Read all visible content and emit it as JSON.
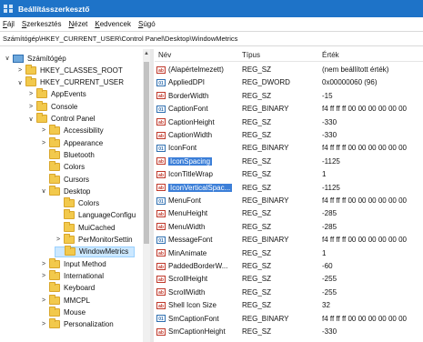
{
  "window": {
    "title": "Beállításszerkesztő"
  },
  "menu": [
    "Fájl",
    "Szerkesztés",
    "Nézet",
    "Kedvencek",
    "Súgó"
  ],
  "address": "Számítógép\\HKEY_CURRENT_USER\\Control Panel\\Desktop\\WindowMetrics",
  "tree": {
    "items": [
      {
        "label": "Számítógép",
        "type": "computer",
        "arrow": "∨"
      },
      {
        "label": "HKEY_CLASSES_ROOT",
        "type": "folder",
        "arrow": ">"
      },
      {
        "label": "HKEY_CURRENT_USER",
        "type": "folder",
        "arrow": "∨"
      },
      {
        "label": "AppEvents",
        "type": "folder",
        "arrow": ">"
      },
      {
        "label": "Console",
        "type": "folder",
        "arrow": ">"
      },
      {
        "label": "Control Panel",
        "type": "folder",
        "arrow": "∨"
      },
      {
        "label": "Accessibility",
        "type": "folder",
        "arrow": ">"
      },
      {
        "label": "Appearance",
        "type": "folder",
        "arrow": ">"
      },
      {
        "label": "Bluetooth",
        "type": "folder",
        "arrow": ""
      },
      {
        "label": "Colors",
        "type": "folder",
        "arrow": ""
      },
      {
        "label": "Cursors",
        "type": "folder",
        "arrow": ""
      },
      {
        "label": "Desktop",
        "type": "folder",
        "arrow": "∨"
      },
      {
        "label": "Colors",
        "type": "folder",
        "arrow": ""
      },
      {
        "label": "LanguageConfigu",
        "type": "folder",
        "arrow": ""
      },
      {
        "label": "MuiCached",
        "type": "folder",
        "arrow": ""
      },
      {
        "label": "PerMonitorSettin",
        "type": "folder",
        "arrow": ">"
      },
      {
        "label": "WindowMetrics",
        "type": "folder",
        "arrow": ""
      },
      {
        "label": "Input Method",
        "type": "folder",
        "arrow": ">"
      },
      {
        "label": "International",
        "type": "folder",
        "arrow": ">"
      },
      {
        "label": "Keyboard",
        "type": "folder",
        "arrow": ""
      },
      {
        "label": "MMCPL",
        "type": "folder",
        "arrow": ">"
      },
      {
        "label": "Mouse",
        "type": "folder",
        "arrow": ""
      },
      {
        "label": "Personalization",
        "type": "folder",
        "arrow": ">"
      }
    ]
  },
  "list": {
    "headers": {
      "name": "Név",
      "type": "Típus",
      "value": "Érték"
    },
    "rows": [
      {
        "name": "(Alapértelmezett)",
        "type": "REG_SZ",
        "value": "(nem beállított érték)",
        "icon": "ab"
      },
      {
        "name": "AppliedDPI",
        "type": "REG_DWORD",
        "value": "0x00000060 (96)",
        "icon": "bin"
      },
      {
        "name": "BorderWidth",
        "type": "REG_SZ",
        "value": "-15",
        "icon": "ab"
      },
      {
        "name": "CaptionFont",
        "type": "REG_BINARY",
        "value": "f4 ff ff ff 00 00 00 00 00 00",
        "icon": "bin"
      },
      {
        "name": "CaptionHeight",
        "type": "REG_SZ",
        "value": "-330",
        "icon": "ab"
      },
      {
        "name": "CaptionWidth",
        "type": "REG_SZ",
        "value": "-330",
        "icon": "ab"
      },
      {
        "name": "IconFont",
        "type": "REG_BINARY",
        "value": "f4 ff ff ff 00 00 00 00 00 00",
        "icon": "bin"
      },
      {
        "name": "IconSpacing",
        "type": "REG_SZ",
        "value": "-1125",
        "icon": "ab",
        "highlight": true
      },
      {
        "name": "IconTitleWrap",
        "type": "REG_SZ",
        "value": "1",
        "icon": "ab"
      },
      {
        "name": "IconVerticalSpac...",
        "type": "REG_SZ",
        "value": "-1125",
        "icon": "ab",
        "highlight": true
      },
      {
        "name": "MenuFont",
        "type": "REG_BINARY",
        "value": "f4 ff ff ff 00 00 00 00 00 00",
        "icon": "bin"
      },
      {
        "name": "MenuHeight",
        "type": "REG_SZ",
        "value": "-285",
        "icon": "ab"
      },
      {
        "name": "MenuWidth",
        "type": "REG_SZ",
        "value": "-285",
        "icon": "ab"
      },
      {
        "name": "MessageFont",
        "type": "REG_BINARY",
        "value": "f4 ff ff ff 00 00 00 00 00 00",
        "icon": "bin"
      },
      {
        "name": "MinAnimate",
        "type": "REG_SZ",
        "value": "1",
        "icon": "ab"
      },
      {
        "name": "PaddedBorderW...",
        "type": "REG_SZ",
        "value": "-60",
        "icon": "ab"
      },
      {
        "name": "ScrollHeight",
        "type": "REG_SZ",
        "value": "-255",
        "icon": "ab"
      },
      {
        "name": "ScrollWidth",
        "type": "REG_SZ",
        "value": "-255",
        "icon": "ab"
      },
      {
        "name": "Shell Icon Size",
        "type": "REG_SZ",
        "value": "32",
        "icon": "ab"
      },
      {
        "name": "SmCaptionFont",
        "type": "REG_BINARY",
        "value": "f4 ff ff ff 00 00 00 00 00 00",
        "icon": "bin"
      },
      {
        "name": "SmCaptionHeight",
        "type": "REG_SZ",
        "value": "-330",
        "icon": "ab"
      }
    ]
  }
}
